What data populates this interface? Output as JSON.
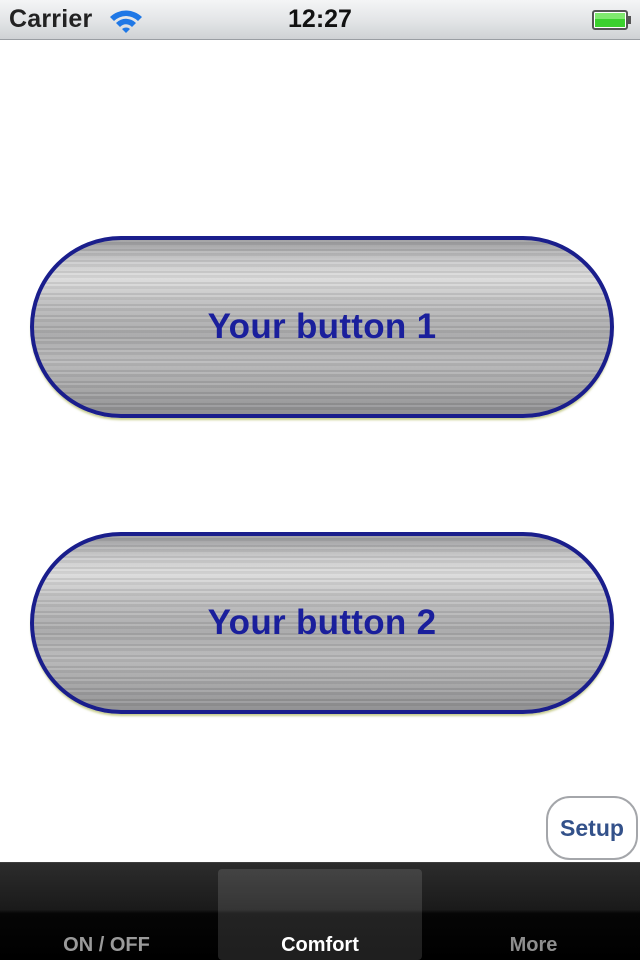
{
  "status_bar": {
    "carrier": "Carrier",
    "time": "12:27",
    "wifi_icon": "wifi-icon",
    "battery_icon": "battery-icon",
    "battery_color": "#3bd12e"
  },
  "main": {
    "button_1_label": "Your button 1",
    "button_2_label": "Your button 2",
    "button_text_color": "#1a1f9c",
    "button_border_color": "#1a1e8c",
    "setup_label": "Setup"
  },
  "tab_bar": {
    "tabs": [
      {
        "label": "ON / OFF",
        "selected": false
      },
      {
        "label": "Comfort",
        "selected": true
      },
      {
        "label": "More",
        "selected": false
      }
    ]
  }
}
